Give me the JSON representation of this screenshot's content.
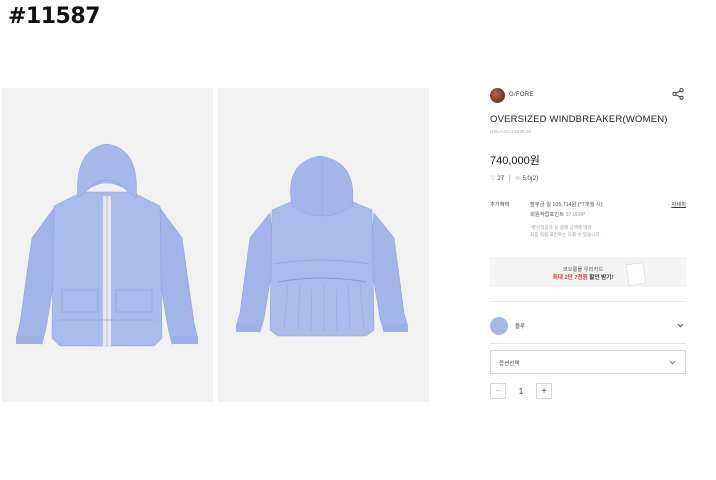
{
  "post_id": "#11587",
  "product": {
    "brand": "G/FORE",
    "title": "OVERSIZED WINDBREAKER(WOMEN)",
    "code": "GNUAM22303NJK",
    "price": "740,000원",
    "likes": "27",
    "rating": "5.0(2)"
  },
  "benefits": {
    "label": "추가혜택",
    "more": "자세히",
    "installment": "할부금 월 105,714원 (*7개월 시)",
    "points_label": "회원적립포인트",
    "points_value": "37,000P",
    "note_line1": "*할인적용과 실 결제 금액에 따라",
    "note_line2": "최종 적립 포인트는 다를 수 있습니다."
  },
  "card_banner": {
    "line1": "코오롱몰 우리카드",
    "line2_prefix": "최대 2만 7천원",
    "line2_suffix": " 할인 받기!"
  },
  "color_option": {
    "name": "블루",
    "swatch": "#a6b7ea"
  },
  "option_select": {
    "label": "옵션선택"
  },
  "quantity": {
    "value": "1",
    "minus": "−",
    "plus": "+"
  },
  "icons": [
    "share-icon",
    "heart-icon",
    "star-icon",
    "chevron-down-icon"
  ],
  "colors": {
    "jacket": "#a9bbeb",
    "background": "#f1f1f1",
    "accent_red": "#d33333"
  }
}
